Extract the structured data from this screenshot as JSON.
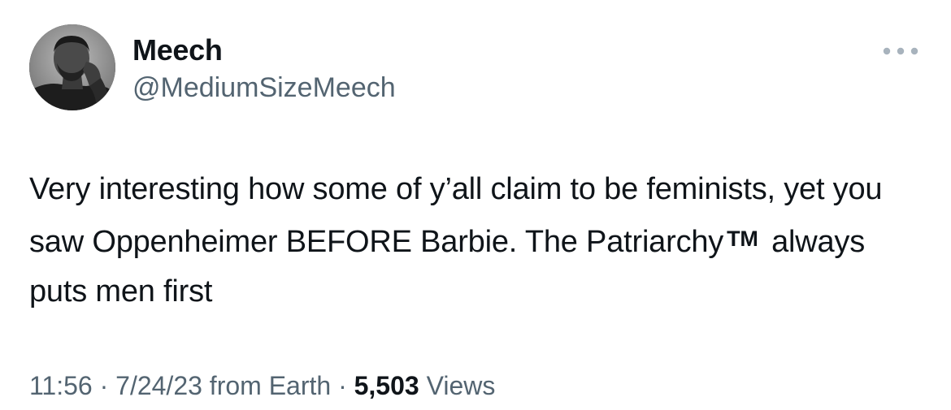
{
  "author": {
    "name": "Meech",
    "handle": "@MediumSizeMeech"
  },
  "tweet": {
    "text_part1": "Very interesting how some of y’all claim to be feminists, yet you saw Oppenheimer BEFORE Barbie. The Patriarchy",
    "trademark": "TM",
    "text_part2": "always puts men first"
  },
  "meta": {
    "time": "11:56",
    "separator1": " · ",
    "date": "7/24/23",
    "source": " from Earth",
    "separator2": " · ",
    "views_count": "5,503",
    "views_label": " Views"
  },
  "icons": {
    "more": "more-horizontal-icon",
    "avatar": "user-avatar"
  },
  "colors": {
    "text_primary": "#0f1419",
    "text_secondary": "#536471",
    "more_icon": "#a8b3bd"
  }
}
